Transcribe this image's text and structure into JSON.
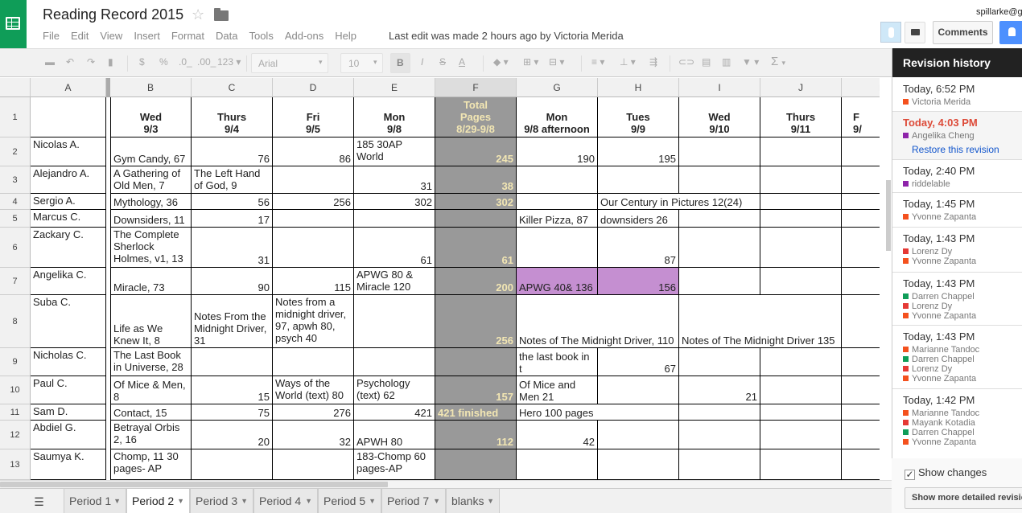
{
  "app": {
    "title": "Reading Record 2015",
    "last_edit": "Last edit was made 2 hours ago by Victoria Merida",
    "user": "spillarke@g",
    "comments_label": "Comments"
  },
  "menu": [
    "File",
    "Edit",
    "View",
    "Insert",
    "Format",
    "Data",
    "Tools",
    "Add-ons",
    "Help"
  ],
  "toolbar": {
    "currency": "$",
    "percent": "%",
    "dec_less": ".0_",
    "dec_more": ".00_",
    "more_formats": "123",
    "font": "Arial",
    "size": "10",
    "bold": "B",
    "italic": "I",
    "strike": "S",
    "text_color": "A",
    "function": "Σ"
  },
  "columns": [
    "A",
    "B",
    "C",
    "D",
    "E",
    "F",
    "G",
    "H",
    "I",
    "J",
    "K"
  ],
  "rows": [
    "1",
    "2",
    "3",
    "4",
    "5",
    "6",
    "7",
    "8",
    "9",
    "10",
    "11",
    "12",
    "13"
  ],
  "cells": {
    "B1": "Wed\n9/3",
    "C1": "Thurs\n9/4",
    "D1": "Fri\n9/5",
    "E1": "Mon\n9/8",
    "F1": "Total\nPages\n8/29-9/8",
    "G1": "Mon\n9/8 afternoon",
    "H1": "Tues\n9/9",
    "I1": "Wed\n9/10",
    "J1": "Thurs\n9/11",
    "K1": "F\n9/",
    "A2": "Nicolas A.",
    "B2": "Gym Candy, 67",
    "C2": "76",
    "D2": "86",
    "E2": "185 30AP\nWorld",
    "F2": "245",
    "G2": "190",
    "H2": "195",
    "A3": "Alejandro A.",
    "B3": "A Gathering of\nOld Men, 7",
    "C3": "The Left Hand\nof God, 9",
    "E3": "31",
    "F3": "38",
    "A4": "Sergio A.",
    "B4": "Mythology, 36",
    "C4": "56",
    "D4": "256",
    "E4": "302",
    "F4": "302",
    "H4": "Our Century in Pictures 12(24)",
    "A5": "Marcus C.",
    "B5": "Downsiders, 11",
    "C5": "17",
    "G5": "Killer Pizza, 87",
    "H5": "downsiders 26",
    "A6": "Zackary C.",
    "B6": "The Complete\nSherlock\nHolmes, v1, 13",
    "C6": "31",
    "E6": "61",
    "F6": "61",
    "H6": "87",
    "A7": "Angelika C.",
    "B7": "Miracle, 73",
    "C7": "90",
    "D7": "115",
    "E7": "APWG 80 &\nMiracle 120",
    "F7": "200",
    "G7": "APWG 40& 136",
    "H7": "156",
    "A8": "Suba C.",
    "B8": "Life as We\nKnew It, 8",
    "C8": "Notes From the\nMidnight Driver,\n31",
    "D8": "Notes from a\nmidnight driver,\n97, apwh 80,\npsych 40",
    "F8": "256",
    "G8": "Notes of The Midnight Driver, 110",
    "I8": "Notes of The Midnight Driver 135",
    "A9": "Nicholas C.",
    "B9": "The Last Book\nin Universe, 28",
    "G9": "the last book in t",
    "H9": "67",
    "A10": "Paul C.",
    "B10": "Of Mice & Men,\n8",
    "C10": "15",
    "D10": "Ways of the\nWorld (text) 80",
    "E10": "Psychology\n(text) 62",
    "F10": "157",
    "G10": "Of Mice and Men 21",
    "I10": "21",
    "A11": "Sam D.",
    "B11": "Contact, 15",
    "C11": "75",
    "D11": "276",
    "E11": "421",
    "F11": "421 finished",
    "G11": "Hero 100 pages",
    "A12": "Abdiel G.",
    "B12": "Betrayal Orbis\n2, 16",
    "C12": "20",
    "D12": "32",
    "E12": "APWH 80",
    "F12": "112",
    "G12": "42",
    "A13": "Saumya K.",
    "B13": "Chomp, 11 30\npages- AP",
    "E13": "183-Chomp 60\npages-AP"
  },
  "sheet_tabs": [
    "Period 1",
    "Period 2",
    "Period 3",
    "Period 4",
    "Period 5",
    "Period 7",
    "blanks"
  ],
  "active_sheet": "Period 2",
  "revision": {
    "title": "Revision history",
    "restore_label": "Restore this revision",
    "show_changes": "Show changes",
    "more_detailed": "Show more detailed revisions",
    "entries": [
      {
        "time": "Today, 6:52 PM",
        "users": [
          {
            "name": "Victoria Merida",
            "color": "#f4511e"
          }
        ]
      },
      {
        "time": "Today, 4:03 PM",
        "users": [
          {
            "name": "Angelika Cheng",
            "color": "#8e24aa"
          }
        ]
      },
      {
        "time": "Today, 2:40 PM",
        "users": [
          {
            "name": "riddelable",
            "color": "#8e24aa"
          }
        ]
      },
      {
        "time": "Today, 1:45 PM",
        "users": [
          {
            "name": "Yvonne Zapanta",
            "color": "#f4511e"
          }
        ]
      },
      {
        "time": "Today, 1:43 PM",
        "users": [
          {
            "name": "Lorenz Dy",
            "color": "#e53935"
          },
          {
            "name": "Yvonne Zapanta",
            "color": "#f4511e"
          }
        ]
      },
      {
        "time": "Today, 1:43 PM",
        "users": [
          {
            "name": "Darren Chappel",
            "color": "#0f9d58"
          },
          {
            "name": "Lorenz Dy",
            "color": "#e53935"
          },
          {
            "name": "Yvonne Zapanta",
            "color": "#f4511e"
          }
        ]
      },
      {
        "time": "Today, 1:43 PM",
        "users": [
          {
            "name": "Marianne Tandoc",
            "color": "#f4511e"
          },
          {
            "name": "Darren Chappel",
            "color": "#0f9d58"
          },
          {
            "name": "Lorenz Dy",
            "color": "#e53935"
          },
          {
            "name": "Yvonne Zapanta",
            "color": "#f4511e"
          }
        ]
      },
      {
        "time": "Today, 1:42 PM",
        "users": [
          {
            "name": "Marianne Tandoc",
            "color": "#f4511e"
          },
          {
            "name": "Mayank Kotadia",
            "color": "#e53935"
          },
          {
            "name": "Darren Chappel",
            "color": "#0f9d58"
          },
          {
            "name": "Yvonne Zapanta",
            "color": "#f4511e"
          }
        ]
      }
    ]
  },
  "colors": {
    "total_column_bg": "#999999",
    "total_column_text": "#f2e6b3",
    "highlight_purple": "#c58fd1",
    "selected_revision_time": "#dd4b39",
    "brand_green": "#0f9d58"
  }
}
